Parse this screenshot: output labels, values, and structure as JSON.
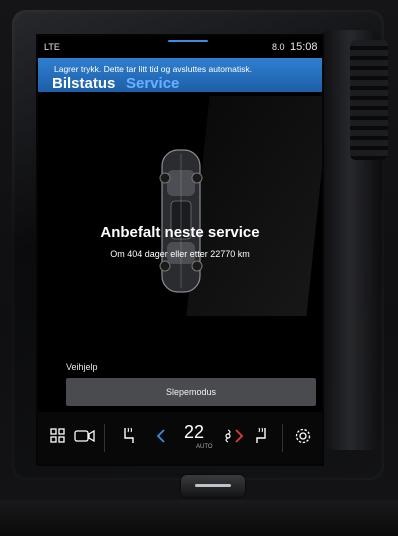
{
  "status_bar": {
    "network": "LTE",
    "right_indicator": "8.0",
    "time": "15:08"
  },
  "banner": {
    "message": "Lagrer trykk. Dette tar litt tid og avsluttes automatisk."
  },
  "tabs": [
    {
      "label": "Bilstatus"
    },
    {
      "label": "Service"
    }
  ],
  "service": {
    "title": "Anbefalt neste service",
    "subtitle": "Om 404 dager eller etter 22770 km"
  },
  "roadside": {
    "label": "Veihjelp",
    "button_label": "Slepemodus"
  },
  "climate": {
    "temperature": "22",
    "mode": "AUTO"
  },
  "colors": {
    "banner": "#2f7fd0",
    "accent_blue": "#69b1ff",
    "arrow_red": "#e23b3b"
  }
}
